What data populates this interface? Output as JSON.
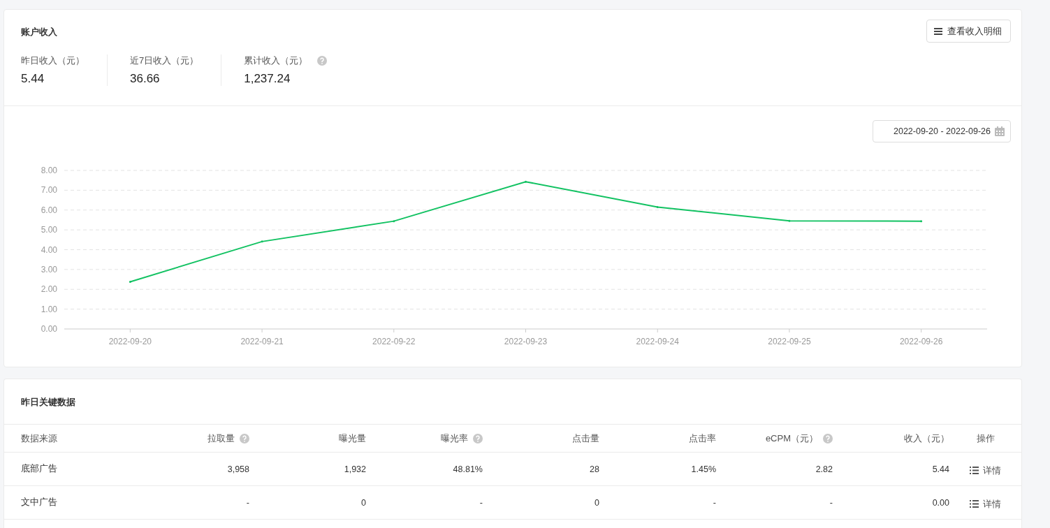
{
  "income": {
    "title": "账户收入",
    "detail_button": "查看收入明细",
    "stats": [
      {
        "label": "昨日收入（元）",
        "value": "5.44",
        "has_help": false
      },
      {
        "label": "近7日收入（元）",
        "value": "36.66",
        "has_help": false
      },
      {
        "label": "累计收入（元）",
        "value": "1,237.24",
        "has_help": true
      }
    ],
    "date_range": "2022-09-20 - 2022-09-26",
    "chart_data": {
      "type": "line",
      "categories": [
        "2022-09-20",
        "2022-09-21",
        "2022-09-22",
        "2022-09-23",
        "2022-09-24",
        "2022-09-25",
        "2022-09-26"
      ],
      "grid": true,
      "series": [
        {
          "color": "#12c262",
          "values": [
            2.38,
            4.41,
            5.44,
            7.43,
            6.15,
            5.45,
            5.44
          ]
        }
      ],
      "ylim": [
        0,
        8
      ],
      "yticks": [
        {
          "value": 0,
          "label": "0.00"
        },
        {
          "value": 1,
          "label": "1.00"
        },
        {
          "value": 2,
          "label": "2.00"
        },
        {
          "value": 3,
          "label": "3.00"
        },
        {
          "value": 4,
          "label": "4.00"
        },
        {
          "value": 5,
          "label": "5.00"
        },
        {
          "value": 6,
          "label": "6.00"
        },
        {
          "value": 7,
          "label": "7.00"
        },
        {
          "value": 8,
          "label": "8.00"
        }
      ]
    }
  },
  "key_data": {
    "title": "昨日关键数据",
    "columns": [
      {
        "label": "数据来源",
        "has_help": false
      },
      {
        "label": "拉取量",
        "has_help": true
      },
      {
        "label": "曝光量",
        "has_help": false
      },
      {
        "label": "曝光率",
        "has_help": true
      },
      {
        "label": "点击量",
        "has_help": false
      },
      {
        "label": "点击率",
        "has_help": false
      },
      {
        "label": "eCPM（元）",
        "has_help": true
      },
      {
        "label": "收入（元）",
        "has_help": false
      },
      {
        "label": "操作",
        "has_help": false
      }
    ],
    "rows": [
      {
        "cells": [
          "底部广告",
          "3,958",
          "1,932",
          "48.81%",
          "28",
          "1.45%",
          "2.82",
          "5.44"
        ],
        "action": "详情"
      },
      {
        "cells": [
          "文中广告",
          "-",
          "0",
          "-",
          "0",
          "-",
          "-",
          "0.00"
        ],
        "action": "详情"
      }
    ]
  }
}
